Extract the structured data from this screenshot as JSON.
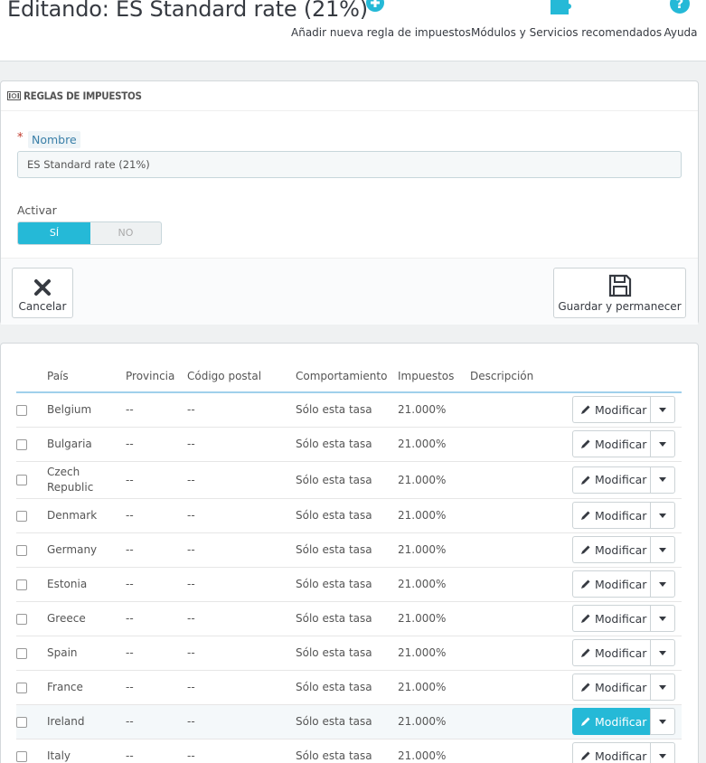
{
  "header": {
    "title": "Editando: ES Standard rate (21%)",
    "toolbar": [
      {
        "label": "Añadir nueva regla de impuestos",
        "icon": "plus-circle-icon"
      },
      {
        "label": "Módulos y Servicios recomendados",
        "icon": "puzzle-icon"
      },
      {
        "label": "Ayuda",
        "icon": "help-icon"
      }
    ]
  },
  "form": {
    "heading": "REGLAS DE IMPUESTOS",
    "required_mark": "*",
    "name_label": "Nombre",
    "name_value": "ES Standard rate (21%)",
    "active_label": "Activar",
    "switch_on": "SÍ",
    "switch_off": "NO",
    "cancel_label": "Cancelar",
    "save_label": "Guardar y permanecer"
  },
  "table": {
    "columns": [
      "País",
      "Provincia",
      "Código postal",
      "Comportamiento",
      "Impuestos",
      "Descripción"
    ],
    "edit_label": "Modificar",
    "rows": [
      {
        "country": "Belgium",
        "province": "--",
        "zip": "--",
        "behavior": "Sólo esta tasa",
        "tax": "21.000%",
        "description": ""
      },
      {
        "country": "Bulgaria",
        "province": "--",
        "zip": "--",
        "behavior": "Sólo esta tasa",
        "tax": "21.000%",
        "description": ""
      },
      {
        "country": "Czech Republic",
        "province": "--",
        "zip": "--",
        "behavior": "Sólo esta tasa",
        "tax": "21.000%",
        "description": ""
      },
      {
        "country": "Denmark",
        "province": "--",
        "zip": "--",
        "behavior": "Sólo esta tasa",
        "tax": "21.000%",
        "description": ""
      },
      {
        "country": "Germany",
        "province": "--",
        "zip": "--",
        "behavior": "Sólo esta tasa",
        "tax": "21.000%",
        "description": ""
      },
      {
        "country": "Estonia",
        "province": "--",
        "zip": "--",
        "behavior": "Sólo esta tasa",
        "tax": "21.000%",
        "description": ""
      },
      {
        "country": "Greece",
        "province": "--",
        "zip": "--",
        "behavior": "Sólo esta tasa",
        "tax": "21.000%",
        "description": ""
      },
      {
        "country": "Spain",
        "province": "--",
        "zip": "--",
        "behavior": "Sólo esta tasa",
        "tax": "21.000%",
        "description": ""
      },
      {
        "country": "France",
        "province": "--",
        "zip": "--",
        "behavior": "Sólo esta tasa",
        "tax": "21.000%",
        "description": ""
      },
      {
        "country": "Ireland",
        "province": "--",
        "zip": "--",
        "behavior": "Sólo esta tasa",
        "tax": "21.000%",
        "description": "",
        "highlighted": true
      },
      {
        "country": "Italy",
        "province": "--",
        "zip": "--",
        "behavior": "Sólo esta tasa",
        "tax": "21.000%",
        "description": ""
      }
    ]
  },
  "colors": {
    "accent": "#25b9d7",
    "table_header_border": "#a0d0eb",
    "required": "#c0392b"
  }
}
